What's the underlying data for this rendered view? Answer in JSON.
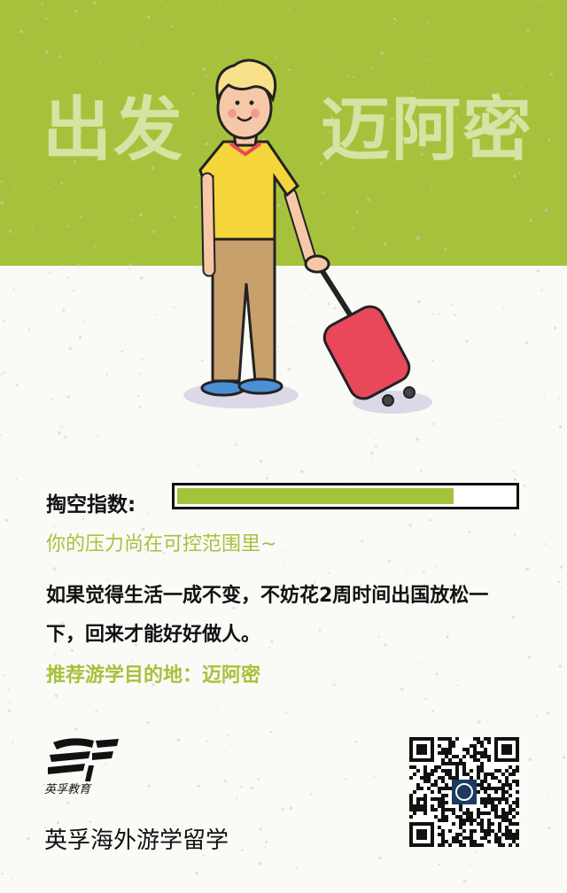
{
  "hero": {
    "left": "出发",
    "right": "迈阿密"
  },
  "meter": {
    "label": "掏空指数:",
    "level_percent": 82
  },
  "status": "你的压力尚在可控范围里~",
  "body": "如果觉得生活一成不变，不妨花2周时间出国放松一下，回来才能好好做人。",
  "recommendation": "推荐游学目的地：迈阿密",
  "footer": {
    "logo_caption": "英孚教育",
    "brand": "英孚海外游学留学"
  },
  "colors": {
    "accent": "#a6c23c",
    "hero_text": "#d6e3a2",
    "suitcase": "#e8485a",
    "shirt": "#f6d53b"
  }
}
